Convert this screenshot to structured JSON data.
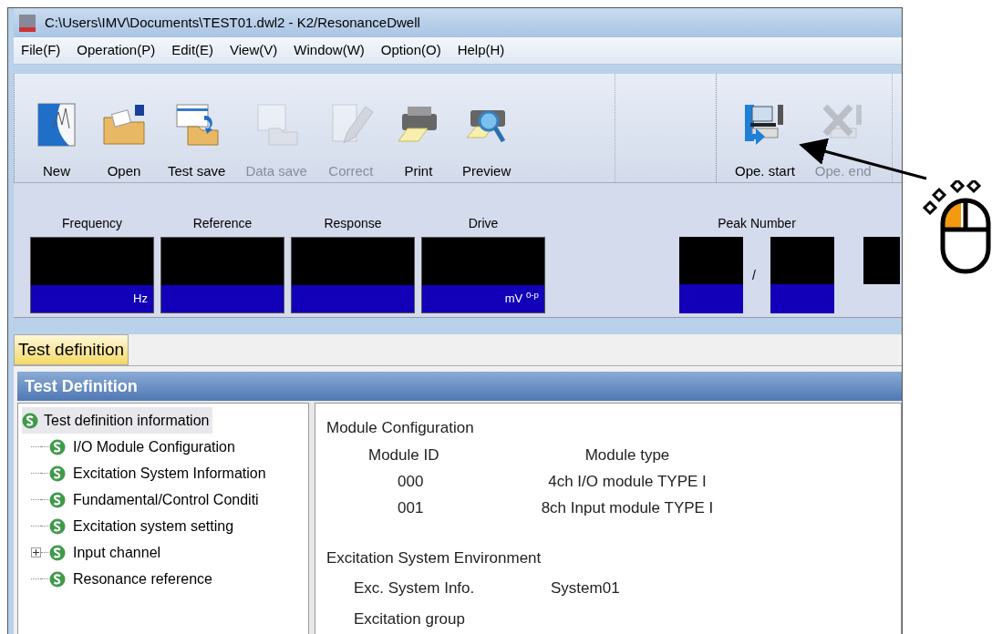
{
  "window": {
    "title": "C:\\Users\\IMV\\Documents\\TEST01.dwl2 - K2/ResonanceDwell"
  },
  "menu": [
    "File(F)",
    "Operation(P)",
    "Edit(E)",
    "View(V)",
    "Window(W)",
    "Option(O)",
    "Help(H)"
  ],
  "toolbar": {
    "groups": [
      {
        "buttons": [
          {
            "label": "New",
            "kind": "new",
            "disabled": false
          },
          {
            "label": "Open",
            "kind": "open",
            "disabled": false
          },
          {
            "label": "Test save",
            "kind": "testsave",
            "disabled": false
          },
          {
            "label": "Data save",
            "kind": "datasave",
            "disabled": true
          },
          {
            "label": "Correct",
            "kind": "correct",
            "disabled": true
          },
          {
            "label": "Print",
            "kind": "print",
            "disabled": false
          },
          {
            "label": "Preview",
            "kind": "preview",
            "disabled": false
          }
        ]
      },
      {
        "buttons": [
          {
            "label": "Ope. start",
            "kind": "start",
            "disabled": false
          },
          {
            "label": "Ope. end",
            "kind": "end",
            "disabled": true
          }
        ]
      }
    ]
  },
  "meters": [
    {
      "label": "Frequency",
      "unit": "Hz"
    },
    {
      "label": "Reference"
    },
    {
      "label": "Response"
    },
    {
      "label": "Drive",
      "unit": "mV $^{0-p}$"
    }
  ],
  "peak_number": {
    "label": "Peak Number",
    "separator": "/"
  },
  "tabs": [
    {
      "label": "Test definition",
      "selected": true
    }
  ],
  "panel": {
    "title": "Test Definition"
  },
  "tree": [
    {
      "label": "Test definition information",
      "selected": true,
      "children": [
        {
          "label": "I/O Module Configuration",
          "selected": false
        },
        {
          "label": "Excitation System Information",
          "selected": false
        },
        {
          "label": "Fundamental/Control Conditi",
          "selected": false
        },
        {
          "label": "Excitation system setting",
          "selected": false
        },
        {
          "label": "Input channel",
          "selected": false,
          "expanded": false
        },
        {
          "label": "Resonance reference",
          "selected": false
        }
      ]
    }
  ],
  "details": {
    "module_configuration": {
      "title": "Module Configuration",
      "columns": [
        "Module ID",
        "Module type"
      ],
      "rows": [
        [
          "000",
          "4ch I/O module TYPE I"
        ],
        [
          "001",
          "8ch Input module TYPE I"
        ]
      ]
    },
    "environment": {
      "title": "Excitation System Environment",
      "fields": [
        {
          "label": "Exc. System Info.",
          "value": "System01"
        },
        {
          "label": "Excitation group"
        }
      ]
    }
  }
}
